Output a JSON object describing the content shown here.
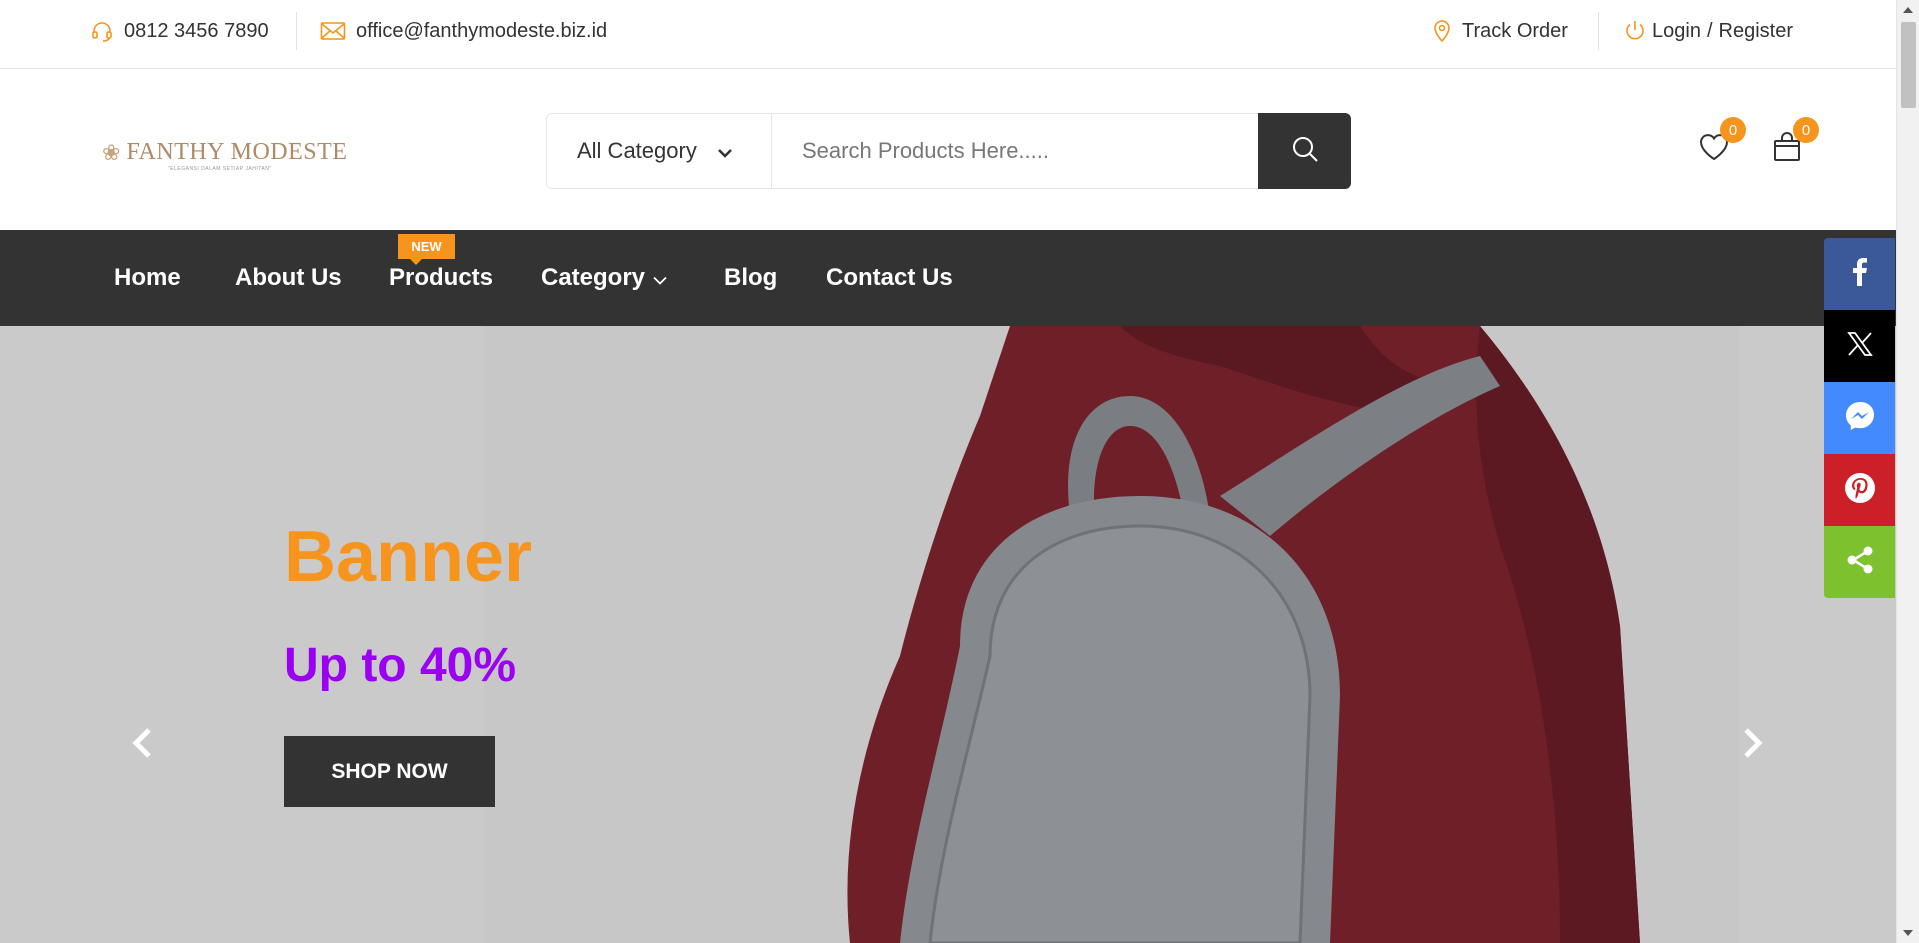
{
  "topbar": {
    "phone": "0812 3456 7890",
    "email": "office@fanthymodeste.biz.id",
    "track_order": "Track Order",
    "login": "Login",
    "slash": "/",
    "register": "Register"
  },
  "header": {
    "logo_name": "FANTHY MODESTE",
    "logo_tagline": "\"ELEGANSI DALAM SETIAP JAHITAN\"",
    "category_selected": "All Category",
    "search_placeholder": "Search Products Here.....",
    "wishlist_count": "0",
    "cart_count": "0"
  },
  "nav": {
    "items": [
      {
        "label": "Home"
      },
      {
        "label": "About Us"
      },
      {
        "label": "Products"
      },
      {
        "label": "Category"
      },
      {
        "label": "Blog"
      },
      {
        "label": "Contact Us"
      }
    ],
    "new_badge": "NEW"
  },
  "hero": {
    "title": "Banner",
    "subtitle": "Up to 40%",
    "button": "SHOP NOW"
  },
  "social": {
    "icons": [
      "facebook-icon",
      "x-twitter-icon",
      "messenger-icon",
      "pinterest-icon",
      "share-icon"
    ],
    "colors": [
      "#3b5998",
      "#000000",
      "#448aff",
      "#cb2027",
      "#7dc12f"
    ]
  },
  "colors": {
    "accent": "#f7941d",
    "purple": "#9b00f2",
    "dark": "#333333"
  }
}
